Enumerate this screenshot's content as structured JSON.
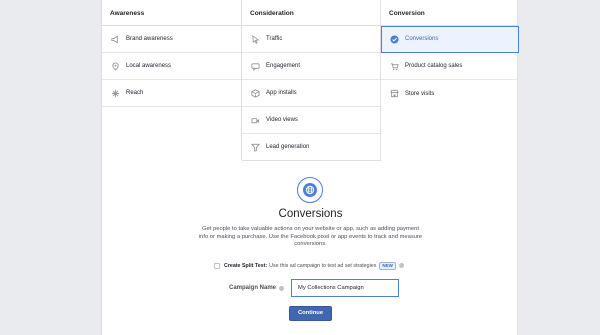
{
  "columns": [
    {
      "header": "Awareness",
      "items": [
        {
          "label": "Brand awareness",
          "icon": "megaphone-icon"
        },
        {
          "label": "Local awareness",
          "icon": "location-pin-icon"
        },
        {
          "label": "Reach",
          "icon": "reach-burst-icon"
        }
      ]
    },
    {
      "header": "Consideration",
      "items": [
        {
          "label": "Traffic",
          "icon": "cursor-icon"
        },
        {
          "label": "Engagement",
          "icon": "chat-icon"
        },
        {
          "label": "App installs",
          "icon": "app-box-icon"
        },
        {
          "label": "Video views",
          "icon": "video-camera-icon"
        },
        {
          "label": "Lead generation",
          "icon": "funnel-icon"
        }
      ]
    },
    {
      "header": "Conversion",
      "items": [
        {
          "label": "Conversions",
          "icon": "check-circle-icon",
          "selected": true
        },
        {
          "label": "Product catalog sales",
          "icon": "cart-icon"
        },
        {
          "label": "Store visits",
          "icon": "store-icon"
        }
      ]
    }
  ],
  "detail": {
    "title": "Conversions",
    "description": "Get people to take valuable actions on your website or app, such as adding payment info or making a purchase. Use the Facebook pixel or app events to track and measure conversions.",
    "icon": "globe-icon"
  },
  "split_test": {
    "label": "Create Split Test:",
    "text": "Use this ad campaign to test ad set strategies",
    "badge": "NEW",
    "checked": false
  },
  "campaign_name": {
    "label": "Campaign Name",
    "value": "My Collections Campaign"
  },
  "continue_label": "Continue",
  "colors": {
    "accent": "#4267b2",
    "selected_bg": "#ecf3ff",
    "border": "#dddfe2"
  }
}
